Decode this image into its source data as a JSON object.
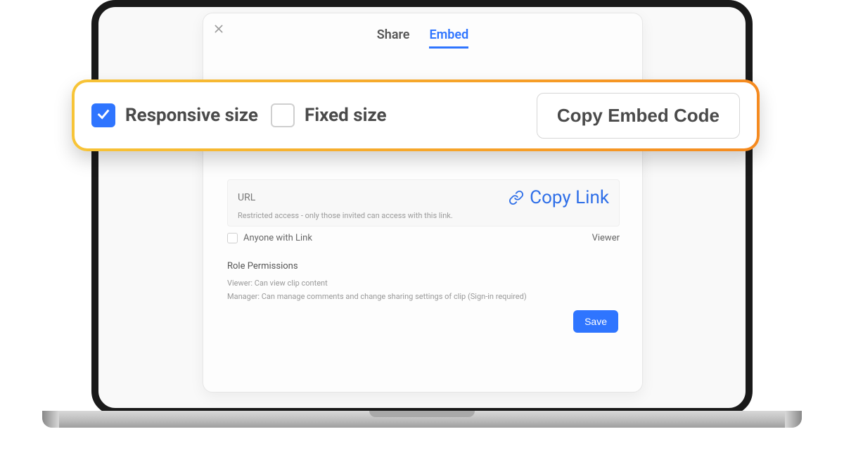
{
  "tabs": {
    "share": "Share",
    "embed": "Embed"
  },
  "callout": {
    "responsive_label": "Responsive size",
    "fixed_label": "Fixed size",
    "copy_embed_label": "Copy Embed Code",
    "responsive_checked": true,
    "fixed_checked": false
  },
  "url_section": {
    "label": "URL",
    "copy_link_label": "Copy Link",
    "note": "Restricted access - only those invited can access with this link."
  },
  "anyone_row": {
    "label": "Anyone with Link",
    "role": "Viewer"
  },
  "role_permissions": {
    "title": "Role Permissions",
    "viewer_line": "Viewer: Can view clip content",
    "manager_line": "Manager: Can manage comments and change sharing settings of clip (Sign-in required)"
  },
  "save_label": "Save"
}
